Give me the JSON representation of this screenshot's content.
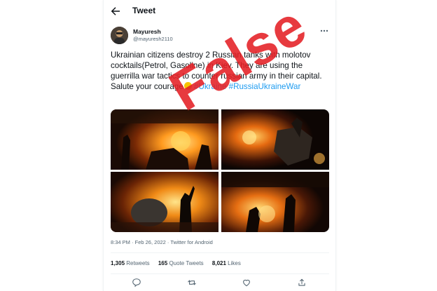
{
  "header": {
    "title": "Tweet",
    "back_icon": "arrow-left-icon"
  },
  "author": {
    "name": "Mayuresh",
    "handle": "@mayuresh2110",
    "avatar_icon": "user-avatar"
  },
  "tweet": {
    "text_main": "Ukrainian citizens destroy 2 Russian tanks with molotov cocktails(Petrol, Gasoline) in Kiev. They are using the guerrilla war tactics to counter russian army in their capital. Salute your courage",
    "emoji": "salute-emoji",
    "hashtag_1": "#Ukraine",
    "hashtag_2": "#RussiaUkraineWar"
  },
  "media": {
    "photo_count": 4,
    "photos": [
      {
        "description_icon": "street-fire-photo"
      },
      {
        "description_icon": "street-fire-photo"
      },
      {
        "description_icon": "street-fire-photo"
      },
      {
        "description_icon": "street-fire-photo"
      }
    ]
  },
  "meta": {
    "time": "8:34 PM",
    "separator": "·",
    "date": "Feb 26, 2022",
    "client": "Twitter for Android",
    "full": "8:34 PM · Feb 26, 2022 · Twitter for Android"
  },
  "stats": {
    "retweets_count": "1,305",
    "retweets_label": "Retweets",
    "quotes_count": "165",
    "quotes_label": "Quote Tweets",
    "likes_count": "8,021",
    "likes_label": "Likes"
  },
  "actions": {
    "reply_icon": "reply-icon",
    "retweet_icon": "retweet-icon",
    "like_icon": "heart-icon",
    "share_icon": "share-icon"
  },
  "overlay": {
    "stamp_text": "False",
    "stamp_color": "#e41f25"
  },
  "colors": {
    "link": "#1d9bf0",
    "text": "#0f1419",
    "secondary": "#536471"
  }
}
